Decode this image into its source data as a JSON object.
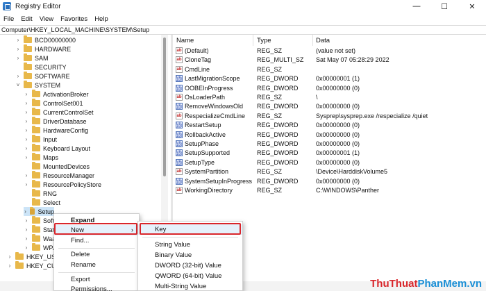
{
  "window": {
    "title": "Registry Editor",
    "minimize": "—",
    "maximize": "☐",
    "close": "✕"
  },
  "menu": [
    "File",
    "Edit",
    "View",
    "Favorites",
    "Help"
  ],
  "address": "Computer\\HKEY_LOCAL_MACHINE\\SYSTEM\\Setup",
  "tree": [
    {
      "label": "BCD00000000",
      "chev": "›"
    },
    {
      "label": "HARDWARE",
      "chev": "›"
    },
    {
      "label": "SAM",
      "chev": "›"
    },
    {
      "label": "SECURITY",
      "chev": ""
    },
    {
      "label": "SOFTWARE",
      "chev": "›"
    },
    {
      "label": "SYSTEM",
      "chev": "˅"
    },
    {
      "label": "ActivationBroker",
      "chev": "›"
    },
    {
      "label": "ControlSet001",
      "chev": "›"
    },
    {
      "label": "CurrentControlSet",
      "chev": "›"
    },
    {
      "label": "DriverDatabase",
      "chev": "›"
    },
    {
      "label": "HardwareConfig",
      "chev": "›"
    },
    {
      "label": "Input",
      "chev": "›"
    },
    {
      "label": "Keyboard Layout",
      "chev": "›"
    },
    {
      "label": "Maps",
      "chev": "›"
    },
    {
      "label": "MountedDevices",
      "chev": ""
    },
    {
      "label": "ResourceManager",
      "chev": "›"
    },
    {
      "label": "ResourcePolicyStore",
      "chev": "›"
    },
    {
      "label": "RNG",
      "chev": ""
    },
    {
      "label": "Select",
      "chev": ""
    },
    {
      "label": "Setup",
      "chev": "›"
    },
    {
      "label": "Softw",
      "chev": "›"
    },
    {
      "label": "State",
      "chev": "›"
    },
    {
      "label": "WaaS",
      "chev": "›"
    },
    {
      "label": "WPA",
      "chev": "›"
    },
    {
      "label": "HKEY_USEF",
      "chev": "›"
    },
    {
      "label": "HKEY_CURI",
      "chev": "›"
    }
  ],
  "columns": {
    "name": "Name",
    "type": "Type",
    "data": "Data"
  },
  "values": [
    {
      "name": "(Default)",
      "type": "REG_SZ",
      "data": "(value not set)",
      "icon": "ab"
    },
    {
      "name": "CloneTag",
      "type": "REG_MULTI_SZ",
      "data": "Sat May 07 05:28:29 2022",
      "icon": "ab"
    },
    {
      "name": "CmdLine",
      "type": "REG_SZ",
      "data": "",
      "icon": "ab"
    },
    {
      "name": "LastMigrationScope",
      "type": "REG_DWORD",
      "data": "0x00000001 (1)",
      "icon": "bin"
    },
    {
      "name": "OOBEInProgress",
      "type": "REG_DWORD",
      "data": "0x00000000 (0)",
      "icon": "bin"
    },
    {
      "name": "OsLoaderPath",
      "type": "REG_SZ",
      "data": "\\",
      "icon": "ab"
    },
    {
      "name": "RemoveWindowsOld",
      "type": "REG_DWORD",
      "data": "0x00000000 (0)",
      "icon": "bin"
    },
    {
      "name": "RespecializeCmdLine",
      "type": "REG_SZ",
      "data": "Sysprep\\sysprep.exe /respecialize /quiet",
      "icon": "ab"
    },
    {
      "name": "RestartSetup",
      "type": "REG_DWORD",
      "data": "0x00000000 (0)",
      "icon": "bin"
    },
    {
      "name": "RollbackActive",
      "type": "REG_DWORD",
      "data": "0x00000000 (0)",
      "icon": "bin"
    },
    {
      "name": "SetupPhase",
      "type": "REG_DWORD",
      "data": "0x00000000 (0)",
      "icon": "bin"
    },
    {
      "name": "SetupSupported",
      "type": "REG_DWORD",
      "data": "0x00000001 (1)",
      "icon": "bin"
    },
    {
      "name": "SetupType",
      "type": "REG_DWORD",
      "data": "0x00000000 (0)",
      "icon": "bin"
    },
    {
      "name": "SystemPartition",
      "type": "REG_SZ",
      "data": "\\Device\\HarddiskVolume5",
      "icon": "ab"
    },
    {
      "name": "SystemSetupInProgress",
      "type": "REG_DWORD",
      "data": "0x00000000 (0)",
      "icon": "bin"
    },
    {
      "name": "WorkingDirectory",
      "type": "REG_SZ",
      "data": "C:\\WINDOWS\\Panther",
      "icon": "ab"
    }
  ],
  "context_menu": {
    "expand": "Expand",
    "new": "New",
    "find": "Find...",
    "delete": "Delete",
    "rename": "Rename",
    "export": "Export",
    "permissions": "Permissions..."
  },
  "submenu": {
    "key": "Key",
    "string": "String Value",
    "binary": "Binary Value",
    "dword": "DWORD (32-bit) Value",
    "qword": "QWORD (64-bit) Value",
    "multi": "Multi-String Value"
  },
  "watermark": {
    "part1": "ThuThuat",
    "part2": "PhanMem",
    "part3": ".vn"
  },
  "accent": "#d9262b",
  "selection": "#cce4f7"
}
